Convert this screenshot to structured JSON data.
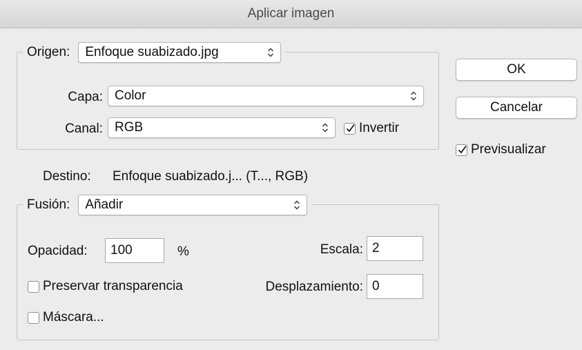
{
  "window": {
    "title": "Aplicar imagen"
  },
  "origin": {
    "legend_label": "Origen:",
    "file_value": "Enfoque suabizado.jpg",
    "layer_label": "Capa:",
    "layer_value": "Color",
    "channel_label": "Canal:",
    "channel_value": "RGB",
    "invert_label": "Invertir",
    "invert_checked": true
  },
  "destination": {
    "label": "Destino:",
    "value": "Enfoque suabizado.j... (T..., RGB)"
  },
  "blending": {
    "legend_label": "Fusión:",
    "mode_value": "Añadir",
    "opacity_label": "Opacidad:",
    "opacity_value": "100",
    "opacity_unit": "%",
    "scale_label": "Escala:",
    "scale_value": "2",
    "offset_label": "Desplazamiento:",
    "offset_value": "0",
    "preserve_transparency_label": "Preservar transparencia",
    "preserve_transparency_checked": false,
    "mask_label": "Máscara...",
    "mask_checked": false
  },
  "buttons": {
    "ok_label": "OK",
    "cancel_label": "Cancelar"
  },
  "preview": {
    "label": "Previsualizar",
    "checked": true
  },
  "icons": {
    "popup_arrows": "updown-chevron-icon",
    "checkmark": "checkmark-icon"
  }
}
